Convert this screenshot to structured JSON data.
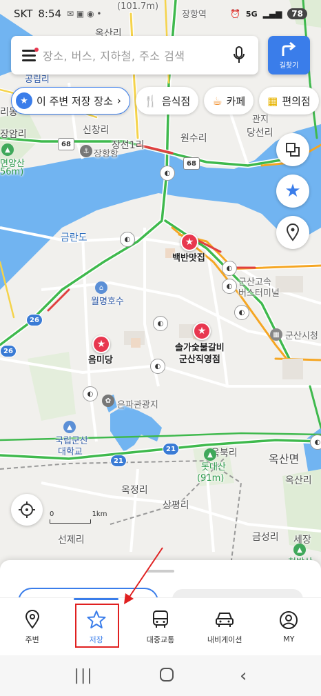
{
  "status_bar": {
    "carrier": "SKT",
    "time": "8:54",
    "network": "5G",
    "battery": "78"
  },
  "search": {
    "placeholder": "장소, 버스, 지하철, 주소 검색",
    "route_button_label": "길찾기"
  },
  "chips": [
    {
      "label": "이 주변 저장 장소",
      "icon": "star-icon"
    },
    {
      "label": "음식점",
      "icon": "fork-knife-icon"
    },
    {
      "label": "카페",
      "icon": "coffee-icon"
    },
    {
      "label": "편의점",
      "icon": "store-icon"
    }
  ],
  "map": {
    "labels": {
      "elevation_top": "(101.7m)",
      "janghang_station": "장항역",
      "oksanri_top": "옥산리",
      "left_a": "공림리",
      "left_b": "리동",
      "jangamri": "장암리",
      "left_mountain": "면양산",
      "left_mountain_height": "56m)",
      "sinchangri": "신창리",
      "janghanghang": "장항항",
      "jangseon1ri": "장선1리",
      "wonsuri": "원수리",
      "dangseonri": "당선리",
      "gwangji": "관지",
      "geumrando": "금란도",
      "baekban": "백반맛집",
      "bus_terminal_a": "군산고속",
      "bus_terminal_b": "버스터미널",
      "wolmyeong_lake": "월명호수",
      "gunsan_city_hall": "군산시청",
      "sol_galbi_a": "솔가숯불갈비",
      "sol_galbi_b": "군산직영점",
      "eummidang": "음미당",
      "eunpa_park": "은파관광지",
      "kunsan_univ_a": "국립군산",
      "kunsan_univ_b": "대학교",
      "okbuk": "옥북리",
      "oksanmyeon": "옥산면",
      "dotdaesan": "돗대산",
      "dotdaesan_height": "(91m)",
      "oksanri_right": "옥산리",
      "okjeongri": "옥정리",
      "sangpyeongri": "상평리",
      "seonjeri": "선제리",
      "geumseongri": "금성리",
      "sejang": "세장",
      "cheonbangsan": "천방산"
    },
    "roads": {
      "r68a": "68",
      "r68b": "68",
      "r26a": "26",
      "r26b": "26",
      "r21a": "21",
      "r21b": "21"
    },
    "scale_label": "1km",
    "scale_zero": "0"
  },
  "bottom_nav": [
    {
      "label": "주변",
      "icon": "location-pin-icon",
      "active": false
    },
    {
      "label": "저장",
      "icon": "star-outline-icon",
      "active": true
    },
    {
      "label": "대중교통",
      "icon": "bus-icon",
      "active": false
    },
    {
      "label": "내비게이션",
      "icon": "car-icon",
      "active": false
    },
    {
      "label": "MY",
      "icon": "user-icon",
      "active": false
    }
  ],
  "colors": {
    "accent": "#3a7dea",
    "pin_red": "#e8374f",
    "water": "#6fb1f0",
    "highlight": "#e02020"
  }
}
